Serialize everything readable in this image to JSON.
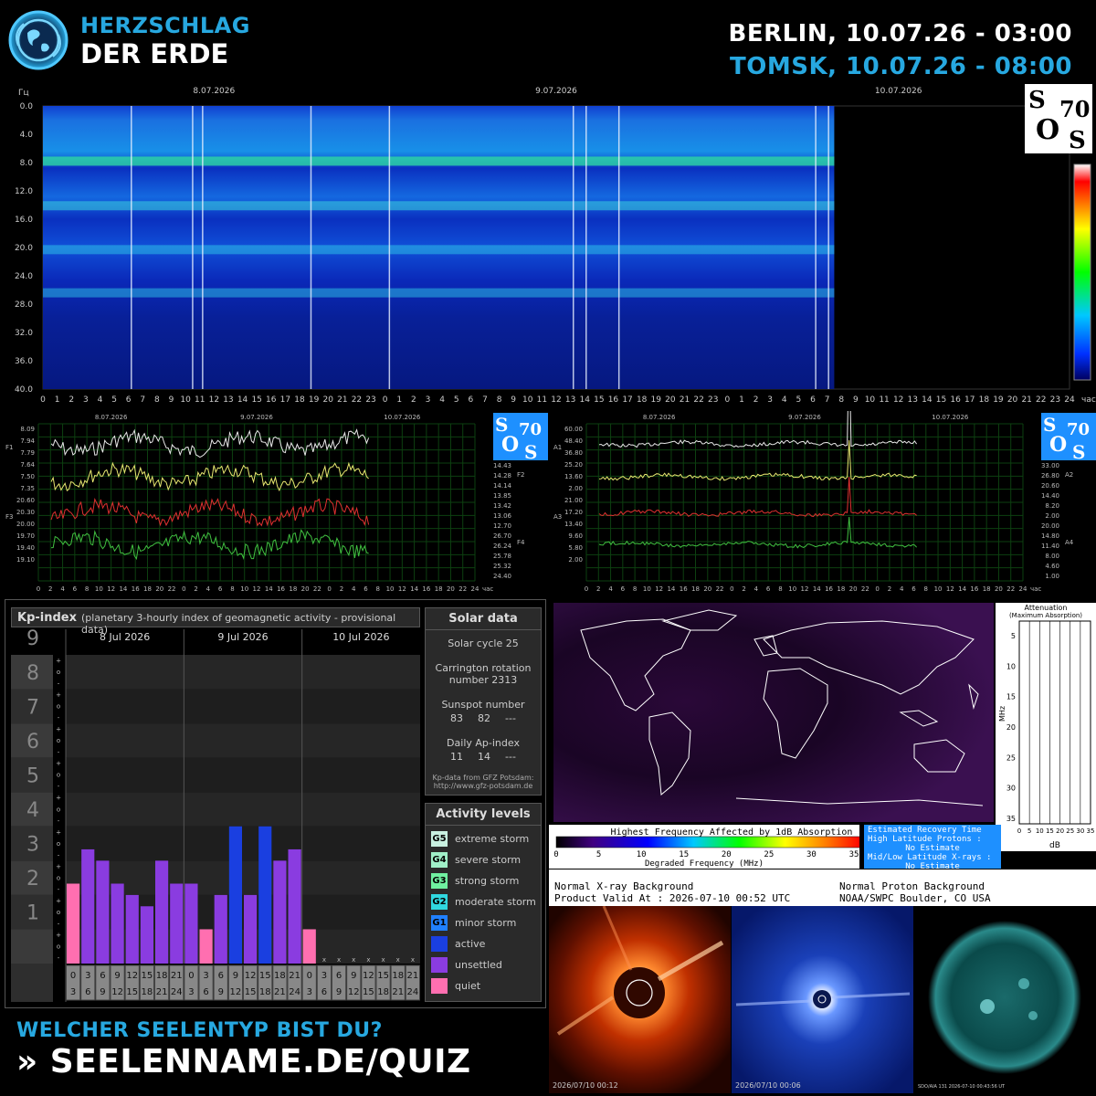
{
  "header": {
    "brand_line1": "HERZSCHLAG",
    "brand_line2": "DER ERDE",
    "berlin_time": "BERLIN, 10.07.26 - 03:00",
    "tomsk_time": "TOMSK, 10.07.26 - 08:00"
  },
  "spectrogram": {
    "ylabel": "Гц",
    "y_ticks": [
      "0.0",
      "4.0",
      "8.0",
      "12.0",
      "16.0",
      "20.0",
      "24.0",
      "28.0",
      "32.0",
      "36.0",
      "40.0"
    ],
    "dates": [
      "8.07.2026",
      "9.07.2026",
      "10.07.2026"
    ],
    "x_unit": "час",
    "x_ticks": [
      "0",
      "1",
      "2",
      "3",
      "4",
      "5",
      "6",
      "7",
      "8",
      "9",
      "10",
      "11",
      "12",
      "13",
      "14",
      "15",
      "16",
      "17",
      "18",
      "19",
      "20",
      "21",
      "22",
      "23",
      "0",
      "1",
      "2",
      "3",
      "4",
      "5",
      "6",
      "7",
      "8",
      "9",
      "10",
      "11",
      "12",
      "13",
      "14",
      "15",
      "16",
      "17",
      "18",
      "19",
      "20",
      "21",
      "22",
      "23",
      "0",
      "1",
      "2",
      "3",
      "4",
      "5",
      "6",
      "7",
      "8",
      "9",
      "10",
      "11",
      "12",
      "13",
      "14",
      "15",
      "16",
      "17",
      "18",
      "19",
      "20",
      "21",
      "22",
      "23",
      "24"
    ],
    "data_until_hour": 55.5,
    "bands_hz": [
      7.8,
      14.1,
      20.3,
      26.4
    ],
    "logo": {
      "s1": "S",
      "n": "70",
      "o": "O",
      "s2": "S"
    }
  },
  "freq_chart": {
    "dates": [
      "8.07.2026",
      "9.07.2026",
      "10.07.2026"
    ],
    "left_labels": [
      "8.09",
      "7.94",
      "7.79",
      "7.64",
      "7.50",
      "7.35",
      "20.60",
      "20.30",
      "20.00",
      "19.70",
      "19.40",
      "19.10"
    ],
    "left_label_colors": [
      "#e8e8e8",
      "#e8e8e8",
      "#e8e8e8",
      "#e8e8e8",
      "#e8e8e8",
      "#e8e8e8",
      "#e03030",
      "#e03030",
      "#e03030",
      "#e03030",
      "#e03030",
      "#e03030"
    ],
    "right_labels": [
      "14.43",
      "14.28",
      "14.14",
      "13.85",
      "13.42",
      "13.06",
      "12.70",
      "26.70",
      "26.24",
      "25.78",
      "25.32",
      "24.40"
    ],
    "right_label_colors": [
      "#e8e870",
      "#e8e870",
      "#e8e870",
      "#e8e870",
      "#e8e870",
      "#e8e870",
      "#e8e870",
      "#40c040",
      "#40c040",
      "#40c040",
      "#40c040",
      "#40c040"
    ],
    "series_names": [
      "F1",
      "F2",
      "F3",
      "F4"
    ]
  },
  "amp_chart": {
    "dates": [
      "8.07.2026",
      "9.07.2026",
      "10.07.2026"
    ],
    "left_labels": [
      "60.00",
      "48.40",
      "36.80",
      "25.20",
      "13.60",
      "2.00",
      "21.00",
      "17.20",
      "13.40",
      "9.60",
      "5.80",
      "2.00"
    ],
    "left_label_colors": [
      "#e8e8e8",
      "#e8e8e8",
      "#e8e8e8",
      "#e8e8e8",
      "#e8e8e8",
      "#e8e8e8",
      "#e03030",
      "#e03030",
      "#e03030",
      "#e03030",
      "#e03030",
      "#e03030"
    ],
    "right_labels": [
      "33.00",
      "26.80",
      "20.60",
      "14.40",
      "8.20",
      "2.00",
      "20.00",
      "14.80",
      "11.40",
      "8.00",
      "4.60",
      "1.00"
    ],
    "right_label_colors": [
      "#e8e870",
      "#e8e870",
      "#e8e870",
      "#e8e870",
      "#e8e870",
      "#e8e870",
      "#40c040",
      "#40c040",
      "#40c040",
      "#40c040",
      "#40c040",
      "#40c040"
    ],
    "series_names": [
      "A1",
      "A2",
      "A3",
      "A4"
    ]
  },
  "chart_data": {
    "type": "bar",
    "title": "Kp-index",
    "subtitle": "(planetary 3-hourly index of geomagnetic activity - provisional data)",
    "days": [
      "8 Jul 2026",
      "9 Jul 2026",
      "10 Jul 2026"
    ],
    "ylim": [
      0,
      9
    ],
    "y_ticks": [
      "0",
      "1",
      "2",
      "3",
      "4",
      "5",
      "6",
      "7",
      "8",
      "9"
    ],
    "x_top": [
      "0",
      "3",
      "6",
      "9",
      "12",
      "15",
      "18",
      "21"
    ],
    "x_bottom": [
      "3",
      "6",
      "9",
      "12",
      "15",
      "18",
      "21",
      "24"
    ],
    "values": [
      2.33,
      3.33,
      3.0,
      2.33,
      2.0,
      1.67,
      3.0,
      2.33,
      2.33,
      1.0,
      2.0,
      4.0,
      2.0,
      4.0,
      3.0,
      3.33,
      1.0
    ],
    "categories": [
      "quiet",
      "unsettled",
      "unsettled",
      "unsettled",
      "unsettled",
      "unsettled",
      "unsettled",
      "unsettled",
      "unsettled",
      "quiet",
      "unsettled",
      "active",
      "unsettled",
      "active",
      "unsettled",
      "unsettled",
      "quiet"
    ],
    "missing_marker": "x",
    "missing_count": 7,
    "category_colors": {
      "quiet": "#ff6fb0",
      "unsettled": "#8a3ce0",
      "active": "#1a3fe0"
    }
  },
  "solar": {
    "title": "Solar data",
    "cycle": "Solar cycle 25",
    "carrington": "Carrington rotation number 2313",
    "sunspot_label": "Sunspot number",
    "sunspot_values": [
      "83",
      "82",
      "---"
    ],
    "ap_label": "Daily Ap-index",
    "ap_values": [
      "11",
      "14",
      "---"
    ],
    "source1": "Kp-data from GFZ Potsdam:",
    "source2": "http://www.gfz-potsdam.de"
  },
  "activity": {
    "title": "Activity levels",
    "items": [
      {
        "code": "G5",
        "label": "extreme storm",
        "color": "#c8f0e0"
      },
      {
        "code": "G4",
        "label": "severe storm",
        "color": "#a0f0c8"
      },
      {
        "code": "G3",
        "label": "strong storm",
        "color": "#70f0a0"
      },
      {
        "code": "G2",
        "label": "moderate storm",
        "color": "#30d8e0"
      },
      {
        "code": "G1",
        "label": "minor storm",
        "color": "#2080ff"
      },
      {
        "code": "",
        "label": "active",
        "color": "#1a3fe0"
      },
      {
        "code": "",
        "label": "unsettled",
        "color": "#8a3ce0"
      },
      {
        "code": "",
        "label": "quiet",
        "color": "#ff6fb0"
      }
    ]
  },
  "drap": {
    "atten_title1": "Attenuation",
    "atten_title2": "(Maximum Absorption)",
    "atten_yticks": [
      "5",
      "10",
      "15",
      "20",
      "25",
      "30",
      "35"
    ],
    "atten_xticks": [
      "0",
      "5",
      "10",
      "15",
      "20",
      "25",
      "30",
      "35"
    ],
    "atten_ylabel": "MHz",
    "atten_xlabel": "dB",
    "scale_title": "Highest Frequency Affected by 1dB Absorption",
    "scale_ticks": [
      "0",
      "5",
      "10",
      "15",
      "20",
      "25",
      "30",
      "35"
    ],
    "scale_xlabel": "Degraded Frequency (MHz)",
    "recovery_title": "Estimated Recovery Time",
    "recovery_high": "High Latitude Protons :",
    "recovery_high_val": "No Estimate",
    "recovery_mid": "Mid/Low Latitude X-rays :",
    "recovery_mid_val": "No Estimate",
    "xray": "Normal X-ray Background",
    "valid": "Product Valid At : 2026-07-10 00:52 UTC",
    "proton": "Normal Proton Background",
    "noaa": "NOAA/SWPC Boulder, CO USA"
  },
  "sun_images": {
    "c2_caption": "2026/07/10 00:12",
    "c3_caption": "2026/07/10 00:06",
    "aia_caption": "SDO/AIA 131   2026-07-10 00:43:56 UT"
  },
  "footer": {
    "question": "WELCHER SEELENTYP BIST DU?",
    "url": "» SEELENNAME.DE/QUIZ"
  }
}
